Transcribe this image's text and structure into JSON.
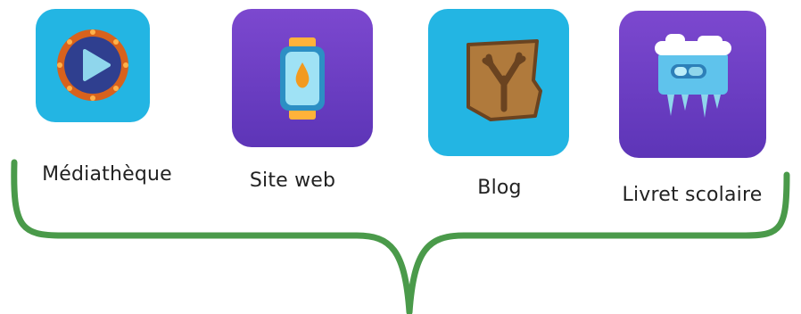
{
  "apps": [
    {
      "id": "mediatheque",
      "label": "Médiathèque",
      "icon": "play-button-icon",
      "tile_color": "#23b5e3"
    },
    {
      "id": "site-web",
      "label": "Site web",
      "icon": "smartwatch-icon",
      "tile_color": "#6b3fc4"
    },
    {
      "id": "blog",
      "label": "Blog",
      "icon": "parchment-icon",
      "tile_color": "#23b5e3"
    },
    {
      "id": "livret-scolaire",
      "label": "Livret scolaire",
      "icon": "frozen-booklet-icon",
      "tile_color": "#6b3fc4"
    }
  ],
  "colors": {
    "brace": "#4a9a4a",
    "cyan_tile": "#23b5e3",
    "purple_tile": "#6b3fc4"
  }
}
